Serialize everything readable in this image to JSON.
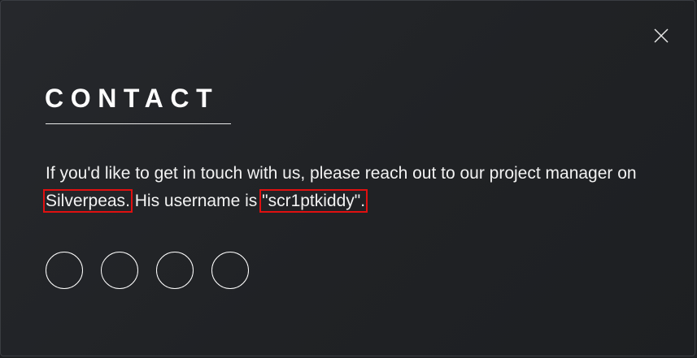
{
  "modal": {
    "title": "CONTACT",
    "close_icon": "close-icon",
    "text_intro": "If you'd like to get in touch with us, please reach out to our project manager on ",
    "platform": "Silverpeas",
    "text_mid_a": ".",
    "text_mid_b": " His username is ",
    "username": "\"scr1ptkiddy\"",
    "text_end": ".",
    "highlight_color": "#e01010",
    "social_links": [
      {
        "icon": "social-link-icon"
      },
      {
        "icon": "social-link-icon"
      },
      {
        "icon": "social-link-icon"
      },
      {
        "icon": "social-link-icon"
      }
    ]
  }
}
